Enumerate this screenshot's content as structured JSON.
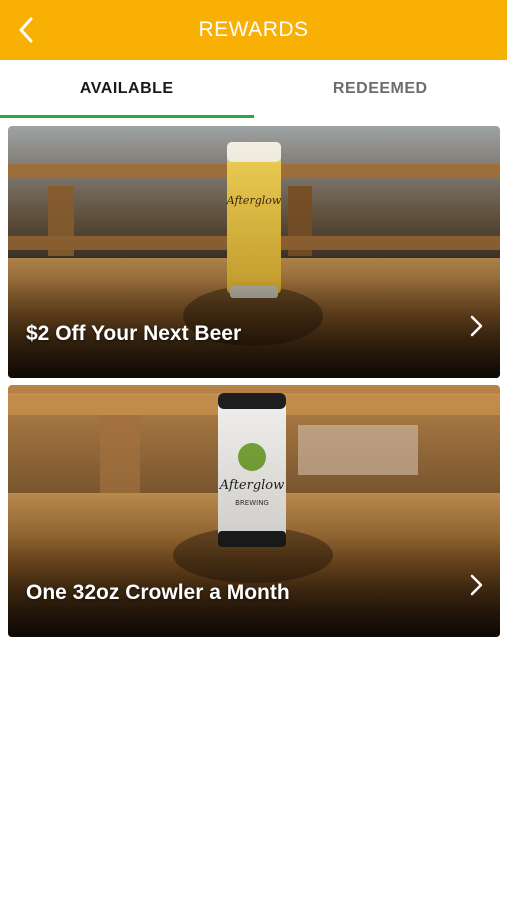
{
  "header": {
    "title": "REWARDS",
    "back_icon": "chevron-left-icon",
    "background": "#f8b005"
  },
  "tabs": [
    {
      "label": "AVAILABLE",
      "active": true
    },
    {
      "label": "REDEEMED",
      "active": false
    }
  ],
  "rewards": [
    {
      "title": "$2 Off Your Next Beer",
      "image": "beer-glass-image",
      "chevron": "chevron-right-icon"
    },
    {
      "title": "One 32oz Crowler a Month",
      "image": "crowler-can-image",
      "chevron": "chevron-right-icon"
    }
  ],
  "colors": {
    "accent": "#f8b005",
    "tab_indicator": "#27a844"
  }
}
